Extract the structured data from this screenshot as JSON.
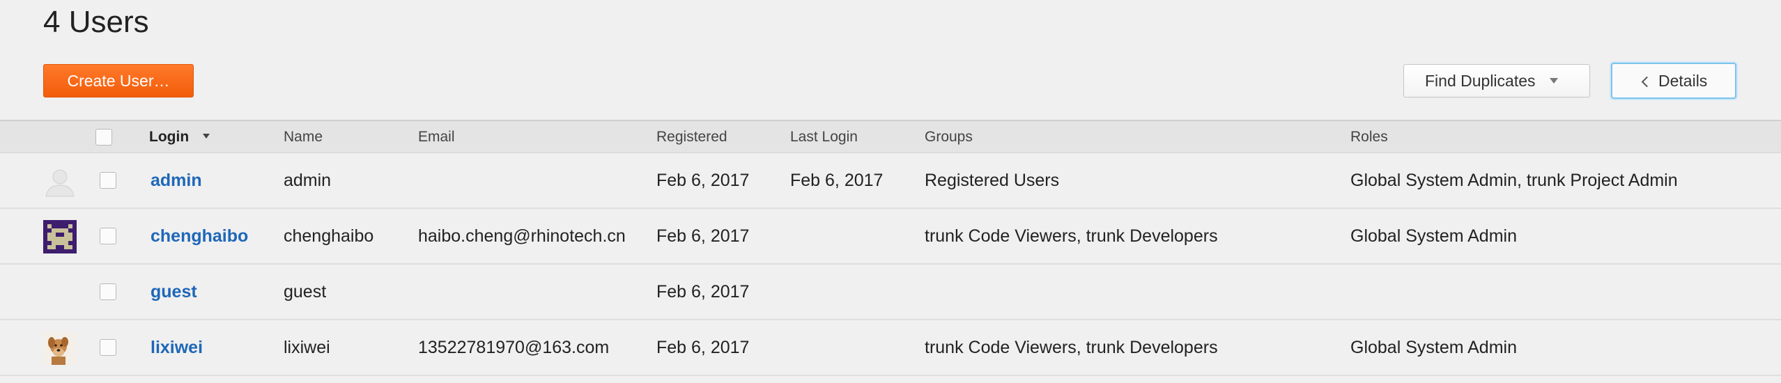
{
  "header": {
    "title": "4 Users",
    "create_label": "Create User…",
    "find_duplicates_label": "Find Duplicates",
    "details_label": "Details"
  },
  "table": {
    "columns": {
      "login": "Login",
      "name": "Name",
      "email": "Email",
      "registered": "Registered",
      "last_login": "Last Login",
      "groups": "Groups",
      "roles": "Roles"
    },
    "rows": [
      {
        "avatar": "default-user-icon",
        "login": "admin",
        "name": "admin",
        "email": "",
        "registered": "Feb 6, 2017",
        "last_login": "Feb 6, 2017",
        "groups": "Registered Users",
        "roles": "Global System Admin, trunk Project Admin"
      },
      {
        "avatar": "pixel-identicon",
        "login": "chenghaibo",
        "name": "chenghaibo",
        "email": "haibo.cheng@rhinotech.cn",
        "registered": "Feb 6, 2017",
        "last_login": "",
        "groups": "trunk Code Viewers, trunk Developers",
        "roles": "Global System Admin"
      },
      {
        "avatar": "",
        "login": "guest",
        "name": "guest",
        "email": "",
        "registered": "Feb 6, 2017",
        "last_login": "",
        "groups": "",
        "roles": ""
      },
      {
        "avatar": "dog-photo",
        "login": "lixiwei",
        "name": "lixiwei",
        "email": "13522781970@163.com",
        "registered": "Feb 6, 2017",
        "last_login": "",
        "groups": "trunk Code Viewers, trunk Developers",
        "roles": "Global System Admin"
      }
    ]
  },
  "colors": {
    "accent": "#f76a1a",
    "link": "#1e67b8",
    "focus_ring": "#7cc3ec"
  }
}
